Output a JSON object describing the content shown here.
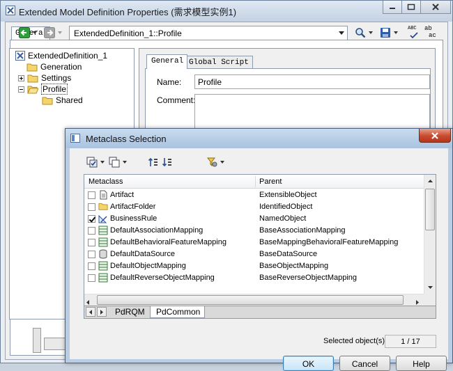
{
  "main_window": {
    "title": "Extended Model Definition Properties (需求模型实例1)",
    "tab": "General",
    "path": "ExtendedDefinition_1::Profile",
    "spell_icon_text": "ABC",
    "replace_icon_text_top": "ab",
    "replace_icon_text_bottom": "ac"
  },
  "tree": {
    "root": "ExtendedDefinition_1",
    "items": [
      "Generation",
      "Settings",
      "Profile",
      "Shared"
    ]
  },
  "detail": {
    "tabs": [
      "General",
      "Global Script"
    ],
    "name_label": "Name:",
    "name_value": "Profile",
    "comment_label": "Comment:"
  },
  "dialog": {
    "title": "Metaclass Selection",
    "columns": [
      "Metaclass",
      "Parent"
    ],
    "rows": [
      {
        "metaclass": "Artifact",
        "parent": "ExtensibleObject",
        "checked": false,
        "icon": "document-icon"
      },
      {
        "metaclass": "ArtifactFolder",
        "parent": "IdentifiedObject",
        "checked": false,
        "icon": "folder-icon"
      },
      {
        "metaclass": "BusinessRule",
        "parent": "NamedObject",
        "checked": true,
        "icon": "business-rule-icon"
      },
      {
        "metaclass": "DefaultAssociationMapping",
        "parent": "BaseAssociationMapping",
        "checked": false,
        "icon": "mapping-icon"
      },
      {
        "metaclass": "DefaultBehavioralFeatureMapping",
        "parent": "BaseMappingBehavioralFeatureMapping",
        "checked": false,
        "icon": "mapping-icon"
      },
      {
        "metaclass": "DefaultDataSource",
        "parent": "BaseDataSource",
        "checked": false,
        "icon": "datasource-icon"
      },
      {
        "metaclass": "DefaultObjectMapping",
        "parent": "BaseObjectMapping",
        "checked": false,
        "icon": "mapping-icon"
      },
      {
        "metaclass": "DefaultReverseObjectMapping",
        "parent": "BaseReverseObjectMapping",
        "checked": false,
        "icon": "mapping-icon"
      }
    ],
    "sheet_tabs": [
      "PdRQM",
      "PdCommon"
    ],
    "selected_label": "Selected object(s):",
    "selected_count": "1 / 17",
    "buttons": {
      "ok": "OK",
      "cancel": "Cancel",
      "help": "Help"
    }
  },
  "colors": {
    "title_bar": "#c3d1e3",
    "close_red": "#c74a2e",
    "ok_focus": "#3c7fb1",
    "back_green": "#2e9e3a"
  }
}
